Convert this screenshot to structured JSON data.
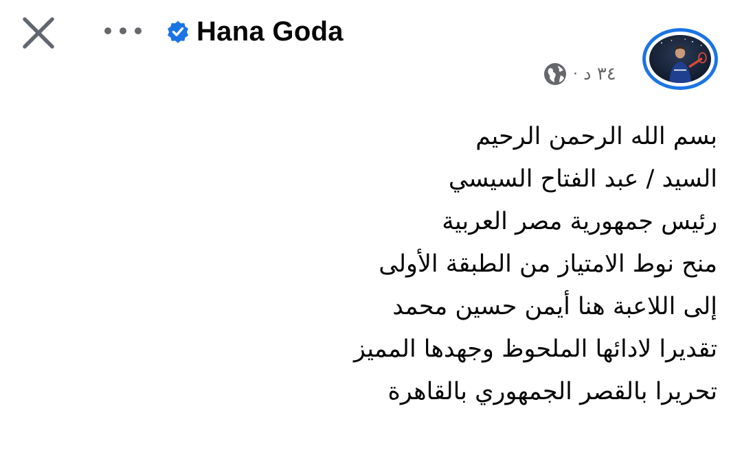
{
  "header": {
    "close_icon": "close-icon",
    "more_icon": "more-options-icon",
    "verified_icon": "verified-badge-icon",
    "author_name": "Hana Goda",
    "accent_color": "#1b74e4"
  },
  "post_meta": {
    "time": "٣٤ د",
    "separator": "·",
    "audience_icon": "globe-icon"
  },
  "post": {
    "lines": [
      "بسم الله الرحمن الرحيم",
      "السيد / عبد الفتاح السيسي",
      "رئيس جمهورية مصر العربية",
      "منح نوط الامتياز من الطبقة الأولى",
      "إلى اللاعبة هنا أيمن حسين محمد",
      "تقديرا لادائها الملحوظ وجهدها المميز",
      "تحريرا بالقصر الجمهوري بالقاهرة"
    ]
  }
}
